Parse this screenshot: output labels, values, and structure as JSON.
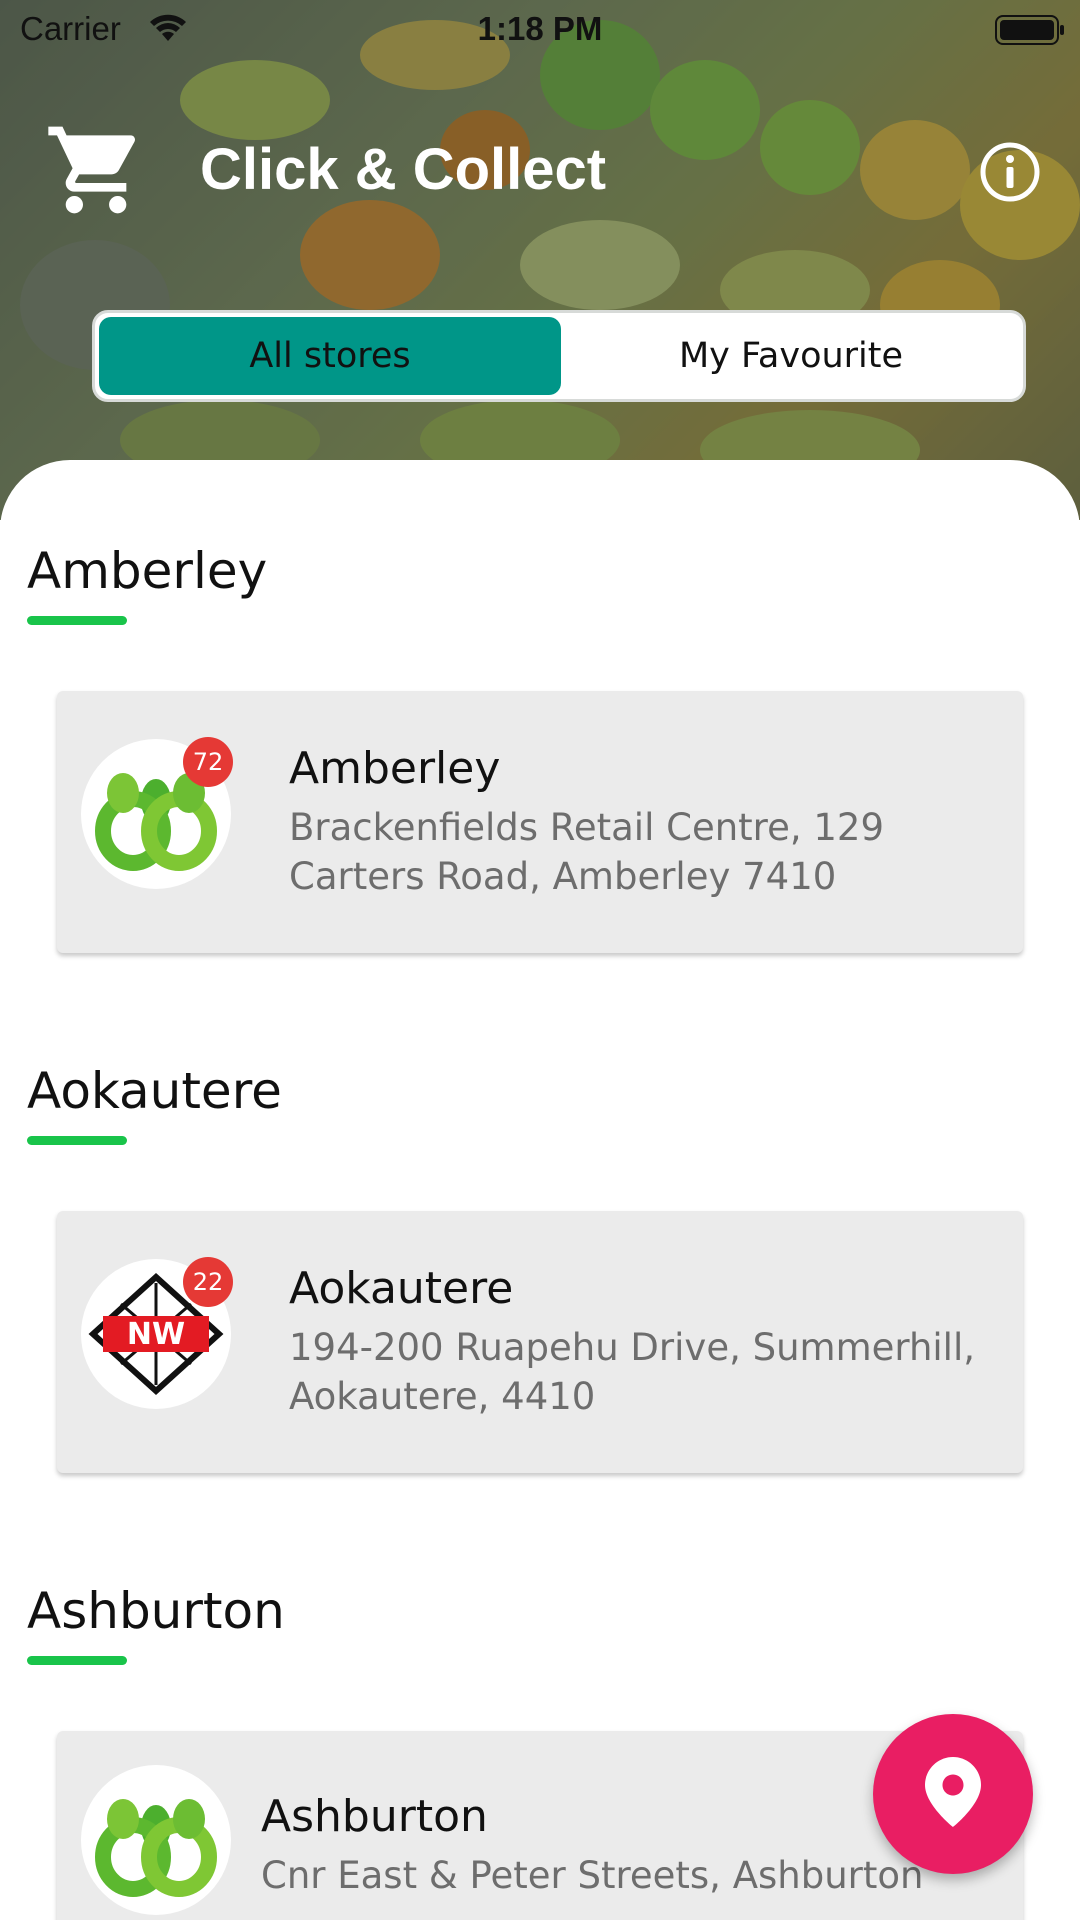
{
  "status_bar": {
    "carrier": "Carrier",
    "time": "1:18 PM"
  },
  "header": {
    "title": "Click & Collect",
    "left_icon": "shopping-cart-icon",
    "right_icon": "info-icon"
  },
  "tabs": [
    {
      "label": "All stores",
      "selected": true
    },
    {
      "label": "My Favourite",
      "selected": false
    }
  ],
  "sections": [
    {
      "title": "Amberley",
      "store": {
        "name": "Amberley",
        "address": "Brackenfields Retail Centre, 129 Carters Road, Amberley 7410",
        "badge": "72",
        "logo": "countdown-logo"
      }
    },
    {
      "title": "Aokautere",
      "store": {
        "name": "Aokautere",
        "address": "194-200 Ruapehu Drive, Summerhill, Aokautere, 4410",
        "badge": "22",
        "logo": "new-world-logo",
        "logo_text": "NW"
      }
    },
    {
      "title": "Ashburton",
      "store": {
        "name": "Ashburton",
        "address": "Cnr East & Peter Streets, Ashburton",
        "logo": "countdown-logo"
      }
    }
  ],
  "fab": {
    "icon": "location-pin-icon"
  },
  "colors": {
    "tab_selected": "#009688",
    "section_underline": "#19c44a",
    "badge": "#e53935",
    "fab": "#e91e63",
    "card_bg": "#ebebeb"
  }
}
